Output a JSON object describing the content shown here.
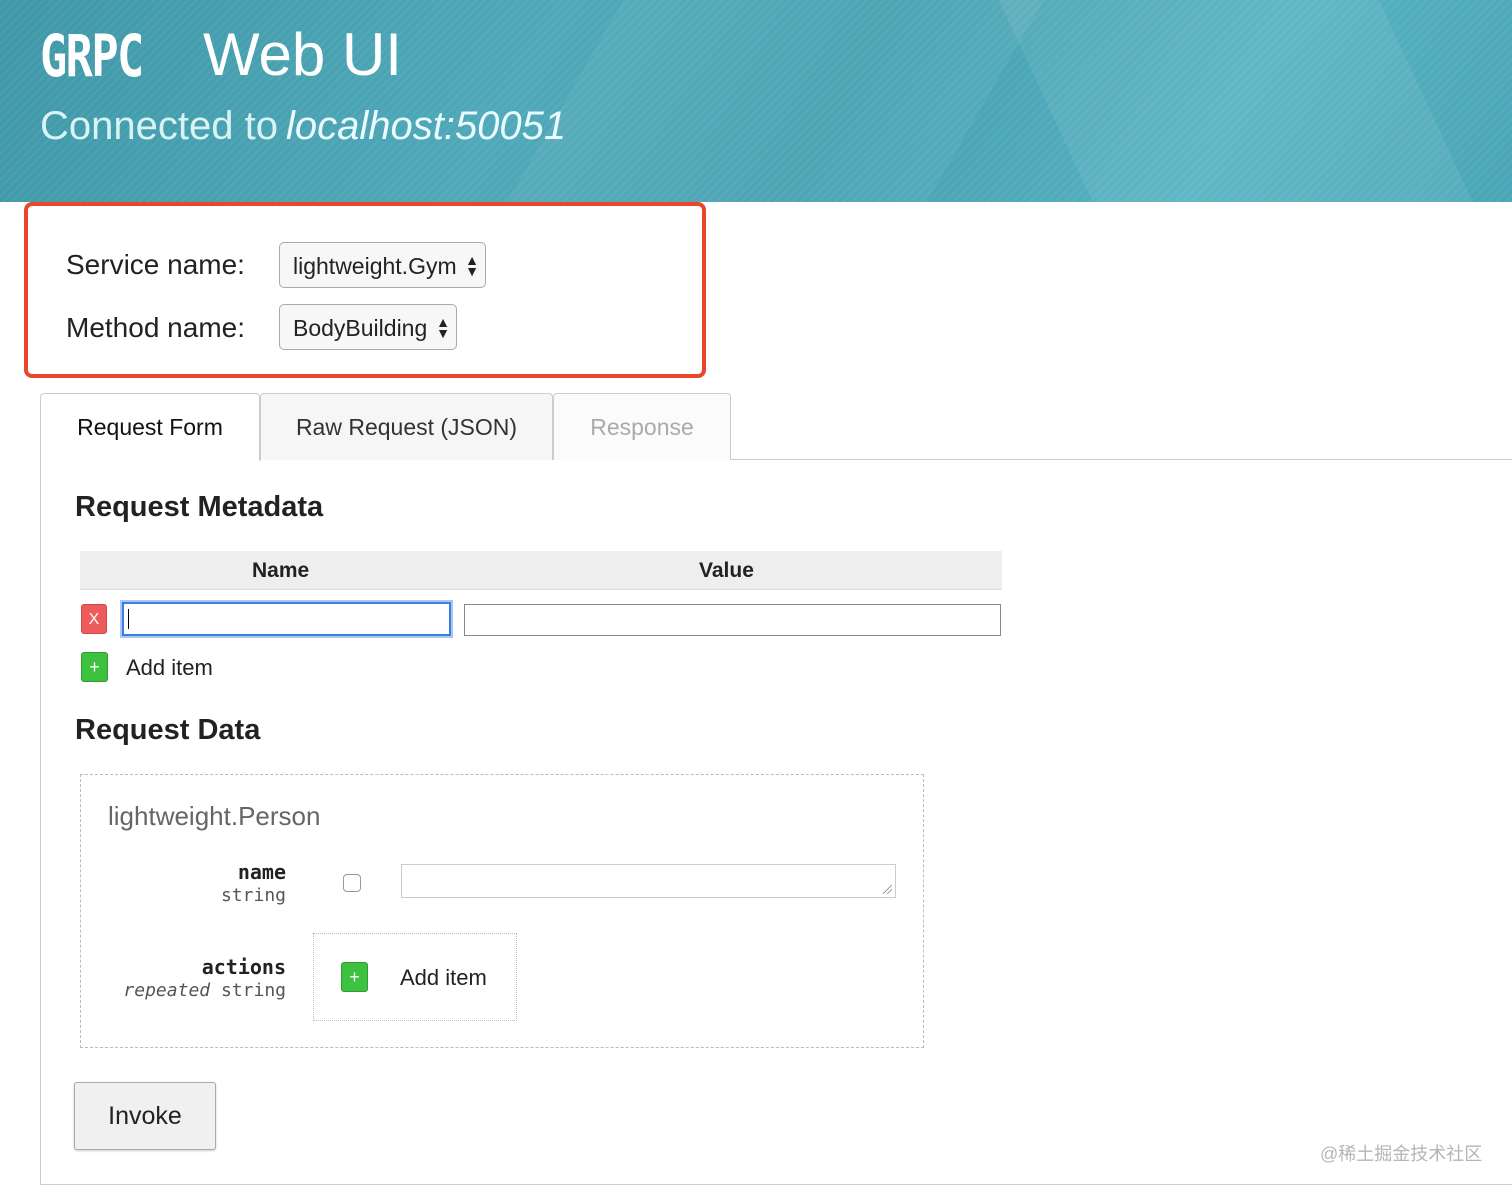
{
  "header": {
    "logo_text": "GRPC",
    "app_title": "Web UI",
    "connected_prefix": "Connected to",
    "host": "localhost:50051"
  },
  "selector": {
    "service_label": "Service name:",
    "service_value": "lightweight.Gym",
    "method_label": "Method name:",
    "method_value": "BodyBuilding"
  },
  "tabs": [
    {
      "label": "Request Form",
      "active": true
    },
    {
      "label": "Raw Request (JSON)",
      "active": false
    },
    {
      "label": "Response",
      "active": false,
      "disabled": true
    }
  ],
  "metadata": {
    "heading": "Request Metadata",
    "col_name": "Name",
    "col_value": "Value",
    "remove_label": "X",
    "add_symbol": "+",
    "add_label": "Add item"
  },
  "request_data": {
    "heading": "Request Data",
    "type_name": "lightweight.Person",
    "fields": [
      {
        "name": "name",
        "type": "string"
      },
      {
        "name": "actions",
        "type_prefix": "repeated",
        "type": "string"
      }
    ],
    "add_symbol": "+",
    "add_label": "Add item"
  },
  "invoke_label": "Invoke",
  "watermark": "@稀土掘金技术社区",
  "colors": {
    "header_bg": "#4aa3b3",
    "highlight_border": "#e8472c",
    "remove_button": "#ef5b5b",
    "add_button": "#3ec13e",
    "focus_outline": "#3b7de0"
  },
  "icons": {
    "select_arrows": "up-down-arrows-icon",
    "remove": "x-icon",
    "add": "plus-icon",
    "resize": "resize-grip-icon"
  }
}
